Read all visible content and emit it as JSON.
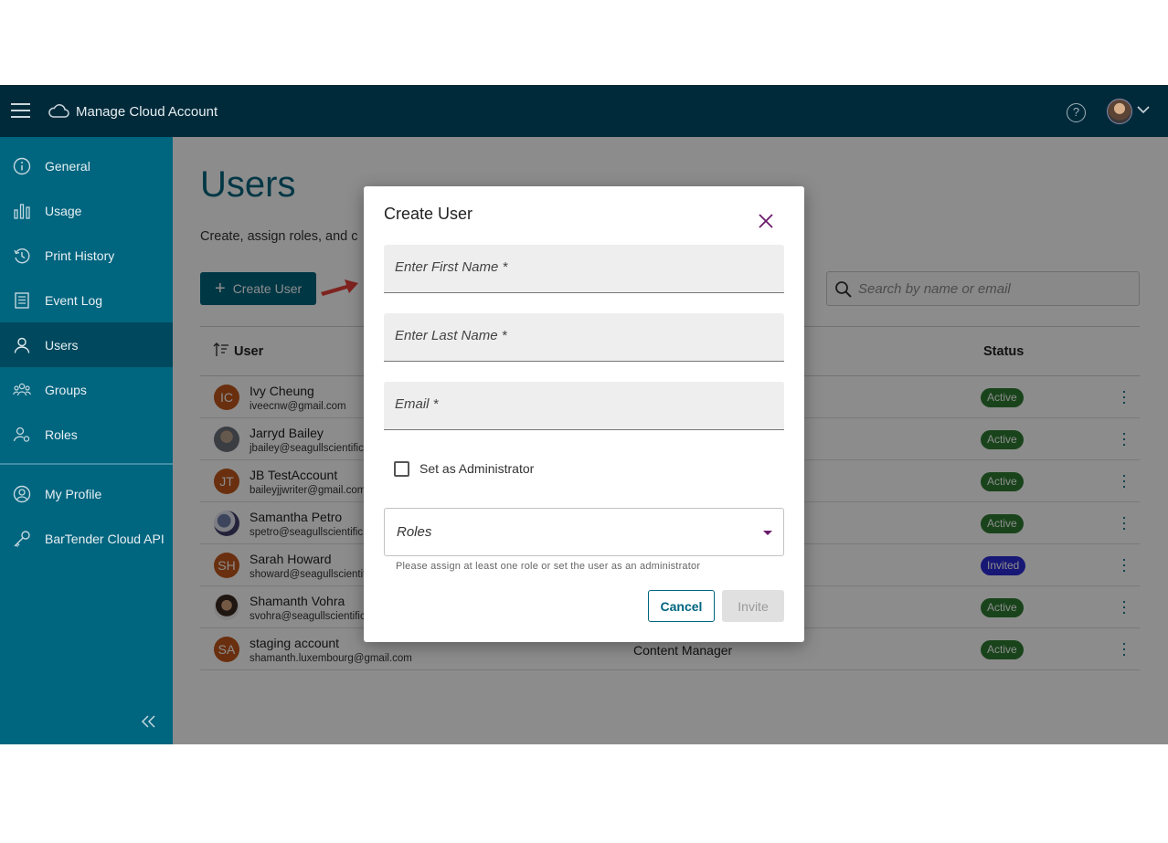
{
  "header": {
    "app_title": "Manage Cloud Account",
    "menu_icon": "hamburger-icon",
    "cloud_icon": "cloud-icon",
    "help_icon": "help-icon",
    "help_glyph": "?"
  },
  "sidebar": {
    "items": [
      {
        "label": "General",
        "icon": "info-icon"
      },
      {
        "label": "Usage",
        "icon": "bar-chart-icon"
      },
      {
        "label": "Print History",
        "icon": "history-icon"
      },
      {
        "label": "Event Log",
        "icon": "log-icon"
      },
      {
        "label": "Users",
        "icon": "user-icon",
        "active": true
      },
      {
        "label": "Groups",
        "icon": "groups-icon"
      },
      {
        "label": "Roles",
        "icon": "roles-icon"
      },
      {
        "label": "My Profile",
        "icon": "profile-icon"
      },
      {
        "label": "BarTender Cloud API",
        "icon": "key-icon"
      }
    ],
    "collapse_icon": "double-chevron-left-icon"
  },
  "main": {
    "title": "Users",
    "subtitle": "Create, assign roles, and c",
    "create_button": "Create User",
    "create_plus": "+",
    "search_placeholder": "Search by name or email",
    "table": {
      "columns": {
        "user": "User",
        "status": "Status"
      },
      "rows": [
        {
          "initials": "IC",
          "name": "Ivy Cheung",
          "email": "iveecnw@gmail.com",
          "role": "",
          "status": "Active"
        },
        {
          "initials": "",
          "name": "Jarryd Bailey",
          "email": "jbailey@seagullscientific",
          "role": "",
          "status": "Active"
        },
        {
          "initials": "JT",
          "name": "JB TestAccount",
          "email": "baileyjjwriter@gmail.com",
          "role": "",
          "status": "Active"
        },
        {
          "initials": "",
          "name": "Samantha Petro",
          "email": "spetro@seagullscientific",
          "role": "",
          "status": "Active"
        },
        {
          "initials": "SH",
          "name": "Sarah Howard",
          "email": "showard@seagullscientif",
          "role": "",
          "status": "Invited"
        },
        {
          "initials": "",
          "name": "Shamanth Vohra",
          "email": "svohra@seagullscientific",
          "role": "",
          "status": "Active"
        },
        {
          "initials": "SA",
          "name": "staging account",
          "email": "shamanth.luxembourg@gmail.com",
          "role": "Content Manager",
          "status": "Active"
        }
      ]
    }
  },
  "modal": {
    "title": "Create User",
    "first_name_placeholder": "Enter First Name *",
    "last_name_placeholder": "Enter Last Name *",
    "email_placeholder": "Email *",
    "admin_checkbox_label": "Set as Administrator",
    "admin_checked": false,
    "roles_label": "Roles",
    "roles_hint": "Please assign at least one role or set the user as an administrator",
    "cancel_label": "Cancel",
    "invite_label": "Invite"
  },
  "colors": {
    "header_bg": "#002a3a",
    "sidebar_bg": "#00657f",
    "sidebar_active": "#00485e",
    "accent": "#00657f",
    "active_badge": "#2e7d32",
    "invited_badge": "#2a2ad8",
    "arrow": "#e8413a"
  }
}
